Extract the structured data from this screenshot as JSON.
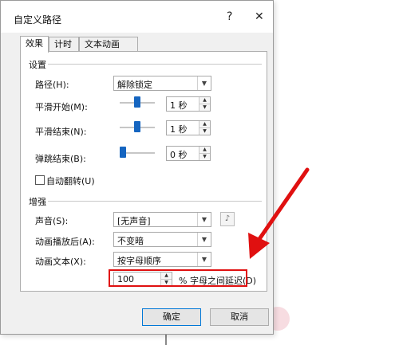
{
  "dialog": {
    "title": "自定义路径",
    "help_glyph": "?",
    "close_glyph": "✕"
  },
  "tabs": [
    {
      "label": "效果"
    },
    {
      "label": "计时"
    },
    {
      "label": "文本动画"
    }
  ],
  "settings": {
    "group_label": "设置",
    "path_label": "路径(H):",
    "path_value": "解除锁定",
    "smooth_start_label": "平滑开始(M):",
    "smooth_start_value": "1 秒",
    "smooth_start_level": 0.5,
    "smooth_end_label": "平滑结束(N):",
    "smooth_end_value": "1 秒",
    "smooth_end_level": 0.5,
    "bounce_end_label": "弹跳结束(B):",
    "bounce_end_value": "0 秒",
    "bounce_end_level": 0.0,
    "auto_reverse_label": "自动翻转(U)"
  },
  "enhance": {
    "group_label": "增强",
    "sound_label": "声音(S):",
    "sound_value": "[无声音]",
    "sound_icon": "speaker-icon",
    "after_anim_label": "动画播放后(A):",
    "after_anim_value": "不变暗",
    "anim_text_label": "动画文本(X):",
    "anim_text_value": "按字母顺序",
    "delay_value": "100",
    "delay_label": "% 字母之间延迟(D)"
  },
  "footer": {
    "ok_label": "确定",
    "cancel_label": "取消"
  },
  "colors": {
    "accent": "#1565c0",
    "highlight": "#e01010",
    "arrow": "#e01010"
  }
}
